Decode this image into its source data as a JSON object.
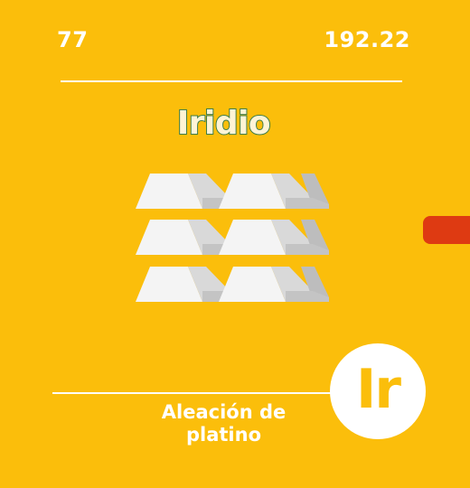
{
  "element": {
    "atomic_number": "77",
    "atomic_mass": "192.22",
    "name": "Iridio",
    "symbol": "Ir",
    "use_caption": "Aleación de platino"
  },
  "illustration": {
    "icon": "metal-ingots-icon",
    "rows": 3,
    "bars_per_row": 2
  },
  "colors": {
    "background": "#FBBE0B",
    "accent_tab": "#DE3A12",
    "title_outline": "#3B7D4A",
    "text": "#FFFFFF"
  }
}
